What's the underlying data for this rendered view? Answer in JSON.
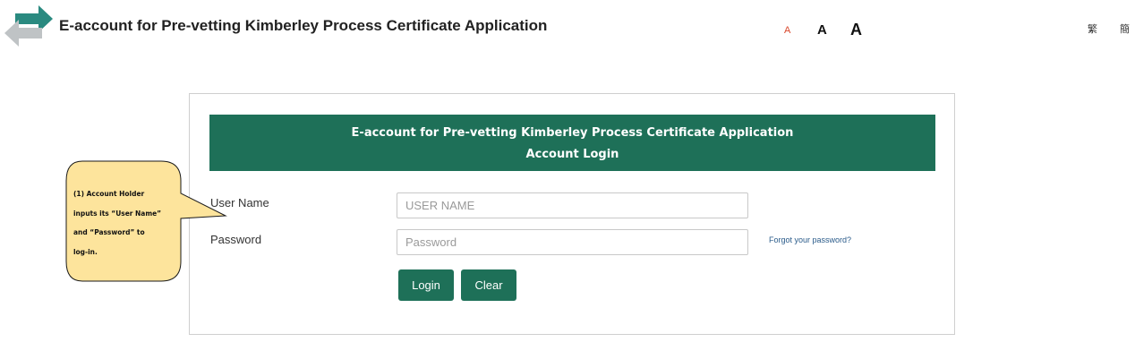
{
  "header": {
    "title": "E-account for Pre-vetting Kimberley Process Certificate Application",
    "font_size_controls": [
      "A",
      "A",
      "A"
    ],
    "languages": {
      "traditional": "繁",
      "simplified": "簡"
    }
  },
  "panel": {
    "header_line1": "E-account for Pre-vetting Kimberley Process Certificate Application",
    "header_line2": "Account Login"
  },
  "form": {
    "username_label": "User Name",
    "username_placeholder": "USER NAME",
    "password_label": "Password",
    "password_placeholder": "Password",
    "forgot_password": "Forgot your password?",
    "login_button": "Login",
    "clear_button": "Clear"
  },
  "annotation": {
    "lines": [
      "(1) Account  Holder",
      "inputs its “User Name”",
      "and  “Password”  to",
      "log-in."
    ]
  },
  "colors": {
    "primary": "#1e7058",
    "callout_fill": "#fde49c",
    "small_a": "#d9472b"
  }
}
